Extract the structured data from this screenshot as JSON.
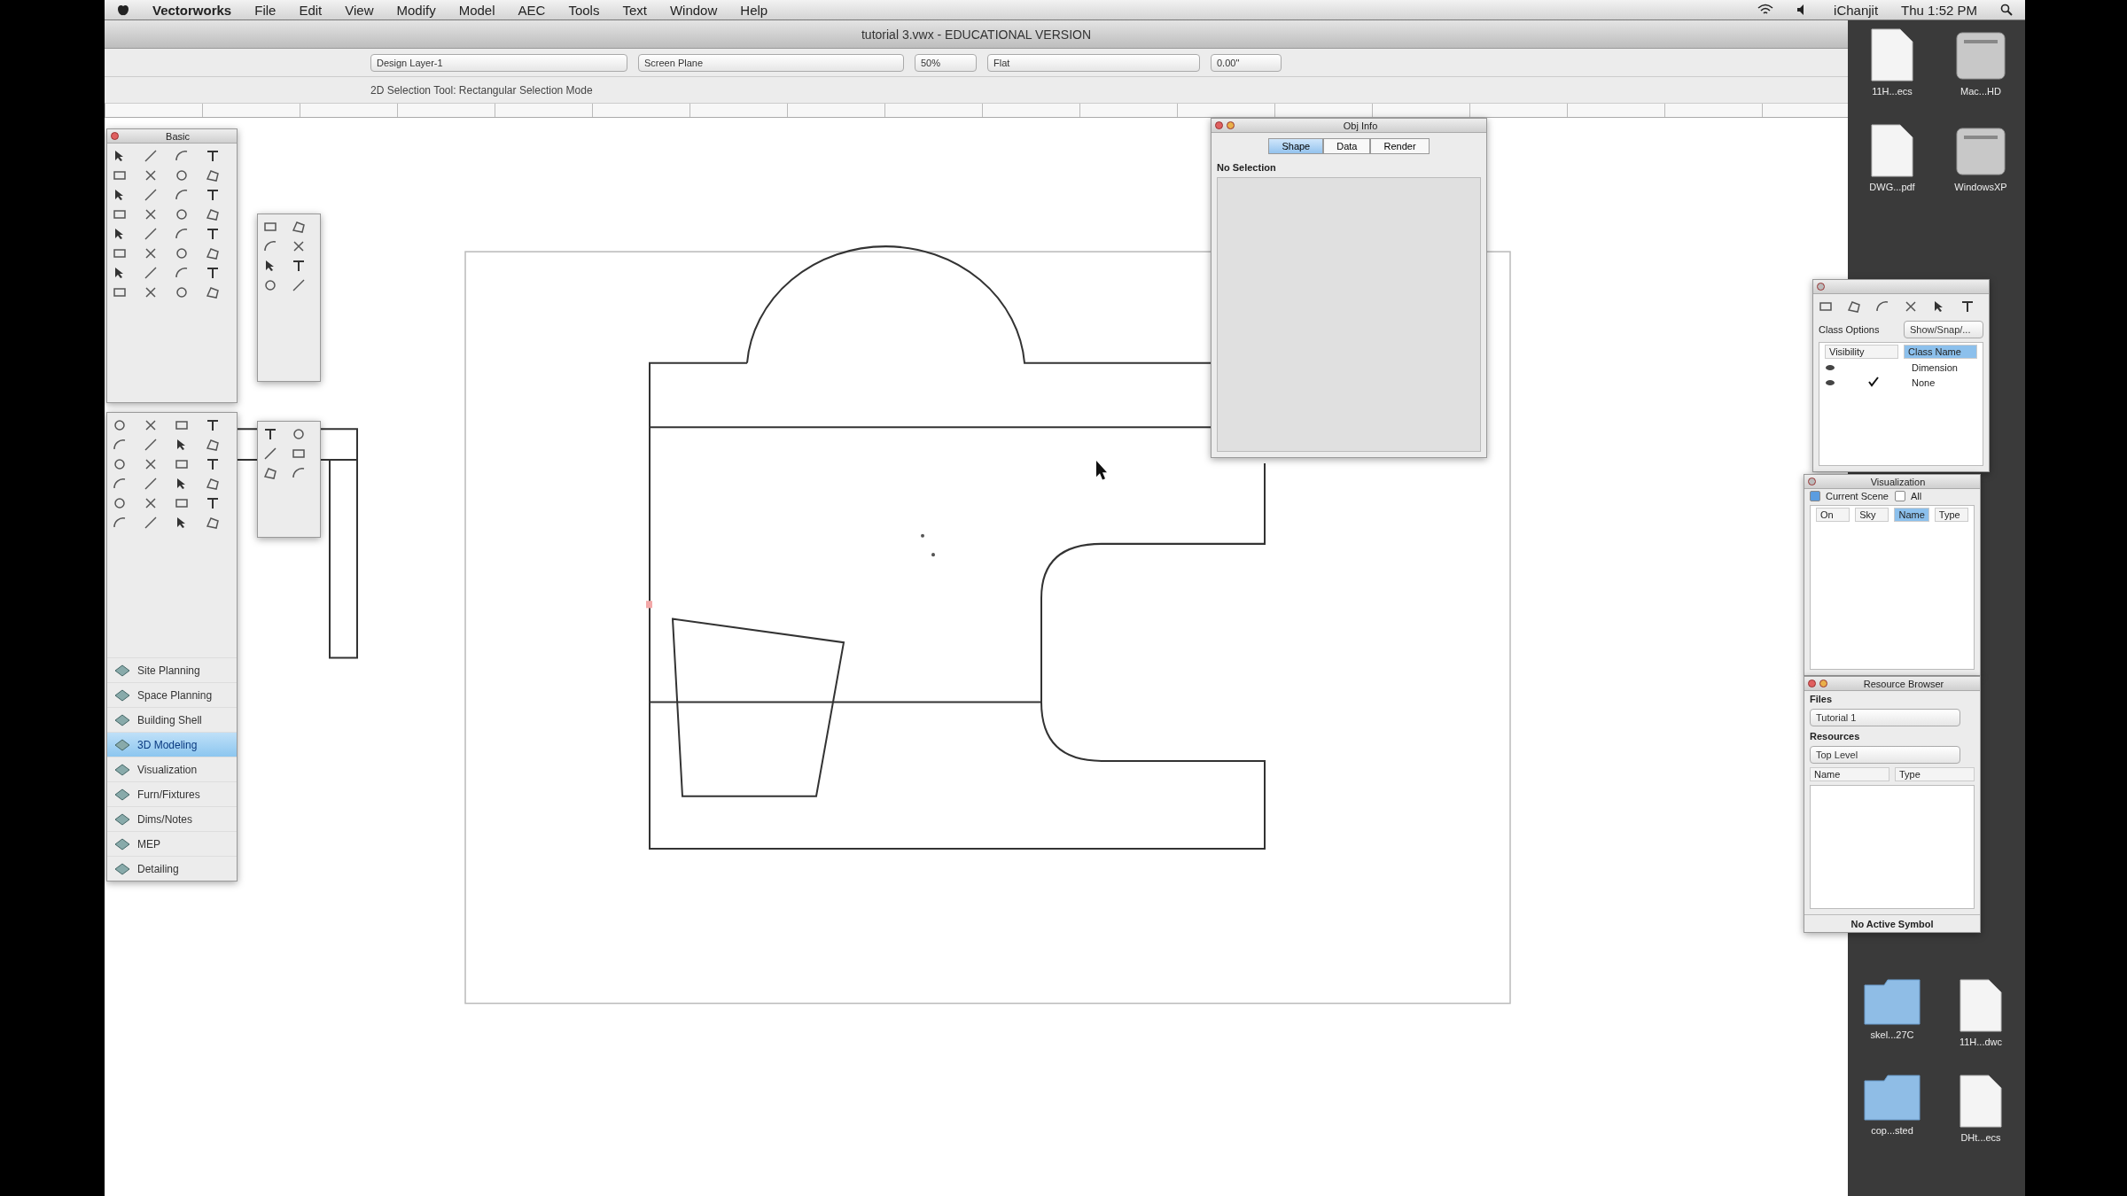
{
  "menu_bar": {
    "app_name": "Vectorworks",
    "items": [
      "File",
      "Edit",
      "View",
      "Modify",
      "Model",
      "AEC",
      "Tools",
      "Text",
      "Window",
      "Help"
    ],
    "user": "iChanjit",
    "clock": "Thu 1:52 PM"
  },
  "window": {
    "title": "tutorial 3.vwx - EDUCATIONAL VERSION"
  },
  "view_bar": {
    "layer": "Design Layer-1",
    "plane": "Screen Plane",
    "zoom": "50%",
    "render_mode": "Flat",
    "offset": "0.00\""
  },
  "mode_bar": {
    "hint": "2D Selection Tool: Rectangular Selection Mode"
  },
  "basic_palette": {
    "title": "Basic"
  },
  "workspace_list": [
    {
      "label": "Site Planning",
      "selected": false
    },
    {
      "label": "Space Planning",
      "selected": false
    },
    {
      "label": "Building Shell",
      "selected": false
    },
    {
      "label": "3D Modeling",
      "selected": true
    },
    {
      "label": "Visualization",
      "selected": false
    },
    {
      "label": "Furn/Fixtures",
      "selected": false
    },
    {
      "label": "Dims/Notes",
      "selected": false
    },
    {
      "label": "MEP",
      "selected": false
    },
    {
      "label": "Detailing",
      "selected": false
    }
  ],
  "obj_info": {
    "title": "Obj Info",
    "tabs": [
      {
        "label": "Shape",
        "selected": true
      },
      {
        "label": "Data",
        "selected": false
      },
      {
        "label": "Render",
        "selected": false
      }
    ],
    "status": "No Selection"
  },
  "navigation_panel": {
    "filter_label": "Class Options",
    "filter_value": "Show/Snap/...",
    "columns": [
      "Visibility",
      "Class Name"
    ],
    "rows": [
      {
        "name": "Dimension",
        "checked": false
      },
      {
        "name": "None",
        "checked": true
      }
    ]
  },
  "visualization_panel": {
    "title": "Visualization",
    "options": [
      {
        "label": "Current Scene",
        "checked": true
      },
      {
        "label": "All",
        "checked": false
      }
    ],
    "columns": [
      {
        "label": "On",
        "selected": false
      },
      {
        "label": "Sky",
        "selected": false
      },
      {
        "label": "Name",
        "selected": true
      },
      {
        "label": "Type",
        "selected": false
      }
    ]
  },
  "resource_browser": {
    "title": "Resource Browser",
    "files_label": "Files",
    "file": "Tutorial 1",
    "resources_label": "Resources",
    "folder": "Top Level",
    "columns": [
      "Name",
      "Type"
    ],
    "status": "No Active Symbol"
  },
  "desktop_icons": [
    {
      "label": "11H...ecs",
      "kind": "document"
    },
    {
      "label": "Mac...HD",
      "kind": "drive"
    },
    {
      "label": "DWG...pdf",
      "kind": "document"
    },
    {
      "label": "WindowsXP",
      "kind": "drive"
    },
    {
      "label": "skel...27C",
      "kind": "folder"
    },
    {
      "label": "11H...dwc",
      "kind": "document"
    },
    {
      "label": "cop...sted",
      "kind": "folder"
    },
    {
      "label": "DHt...ecs",
      "kind": "document"
    }
  ]
}
